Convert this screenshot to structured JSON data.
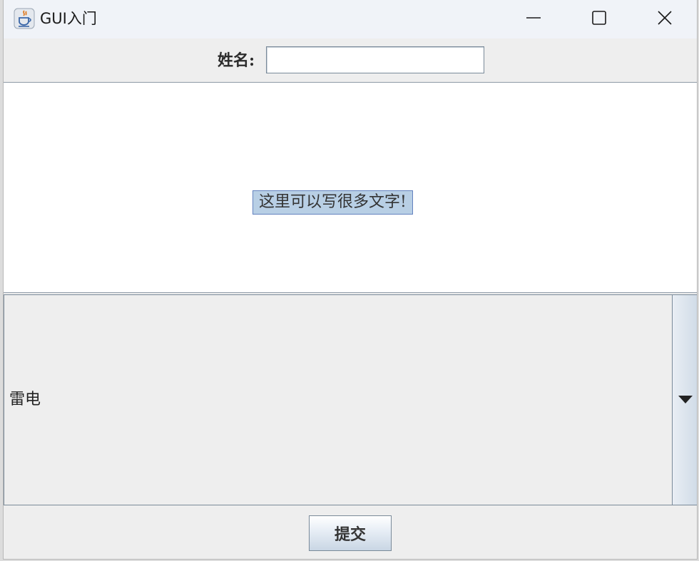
{
  "window": {
    "title": "GUI入门",
    "controls": [
      "minimize",
      "maximize",
      "close"
    ]
  },
  "form": {
    "name_label": "姓名:",
    "name_value": "",
    "text_area": "这里可以写很多文字!",
    "combo_selected": "雷电",
    "submit_label": "提交"
  },
  "icons": {
    "app": "java-coffee-cup-icon",
    "minimize": "minimize-icon",
    "maximize": "maximize-icon",
    "close": "close-icon",
    "dropdown": "triangle-down-icon"
  },
  "colors": {
    "titlebar": "#f0f3f8",
    "panel": "#eeeeee",
    "selection": "#b8cfe5",
    "selection_border": "#6382bf"
  }
}
